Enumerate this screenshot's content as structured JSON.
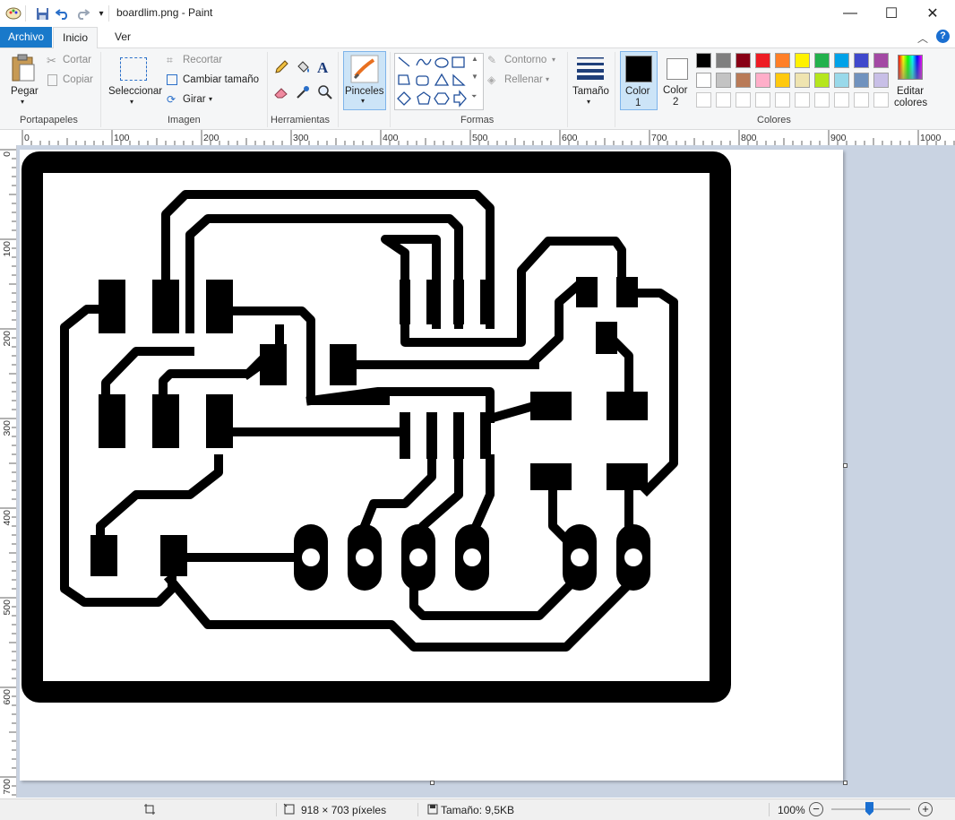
{
  "window": {
    "title": "boardlim.png - Paint",
    "minimize_glyph": "—",
    "maximize_glyph": "☐",
    "close_glyph": "✕"
  },
  "quick_access": {
    "icons": [
      "paint-app-icon",
      "save-icon",
      "undo-icon",
      "redo-icon",
      "customize-dropdown-icon"
    ]
  },
  "tabs": [
    {
      "label": "Archivo"
    },
    {
      "label": "Inicio"
    },
    {
      "label": "Ver"
    }
  ],
  "ribbon": {
    "clipboard": {
      "group_label": "Portapapeles",
      "paste": "Pegar",
      "cut": "Cortar",
      "copy": "Copiar"
    },
    "image": {
      "group_label": "Imagen",
      "select": "Seleccionar",
      "crop": "Recortar",
      "resize": "Cambiar tamaño",
      "rotate": "Girar"
    },
    "tools": {
      "group_label": "Herramientas",
      "items": [
        "pencil-icon",
        "fill-icon",
        "text-icon",
        "eraser-icon",
        "color-picker-icon",
        "magnifier-icon"
      ],
      "text_glyph": "A"
    },
    "brushes": {
      "label": "Pinceles"
    },
    "shapes": {
      "group_label": "Formas",
      "outline": "Contorno",
      "fill": "Rellenar"
    },
    "size": {
      "label": "Tamaño"
    },
    "colors": {
      "group_label": "Colores",
      "color1_label": "Color",
      "color1_num": "1",
      "color1": "#000000",
      "color2_label": "Color",
      "color2_num": "2",
      "color2": "#ffffff",
      "edit_line1": "Editar",
      "edit_line2": "colores",
      "palette_row1": [
        "#000000",
        "#7f7f7f",
        "#880015",
        "#ed1c24",
        "#ff7f27",
        "#fff200",
        "#22b14c",
        "#00a2e8",
        "#3f48cc",
        "#a349a4"
      ],
      "palette_row2": [
        "#ffffff",
        "#c3c3c3",
        "#b97a57",
        "#ffaec9",
        "#ffc90e",
        "#efe4b0",
        "#b5e61d",
        "#99d9ea",
        "#7092be",
        "#c8bfe7"
      ],
      "palette_row3": [
        "#ffffff",
        "#ffffff",
        "#ffffff",
        "#ffffff",
        "#ffffff",
        "#ffffff",
        "#ffffff",
        "#ffffff",
        "#ffffff",
        "#ffffff"
      ]
    }
  },
  "rulers": {
    "horizontal": [
      "0",
      "100",
      "200",
      "300",
      "400",
      "500",
      "600",
      "700",
      "800",
      "900",
      "1000"
    ],
    "vertical": [
      "0",
      "100",
      "200",
      "300",
      "400",
      "500",
      "600",
      "700"
    ]
  },
  "status": {
    "dimensions": "918 × 703 píxeles",
    "file_size": "Tamaño: 9,5KB",
    "zoom": "100%",
    "zoom_out": "−",
    "zoom_in": "+"
  }
}
